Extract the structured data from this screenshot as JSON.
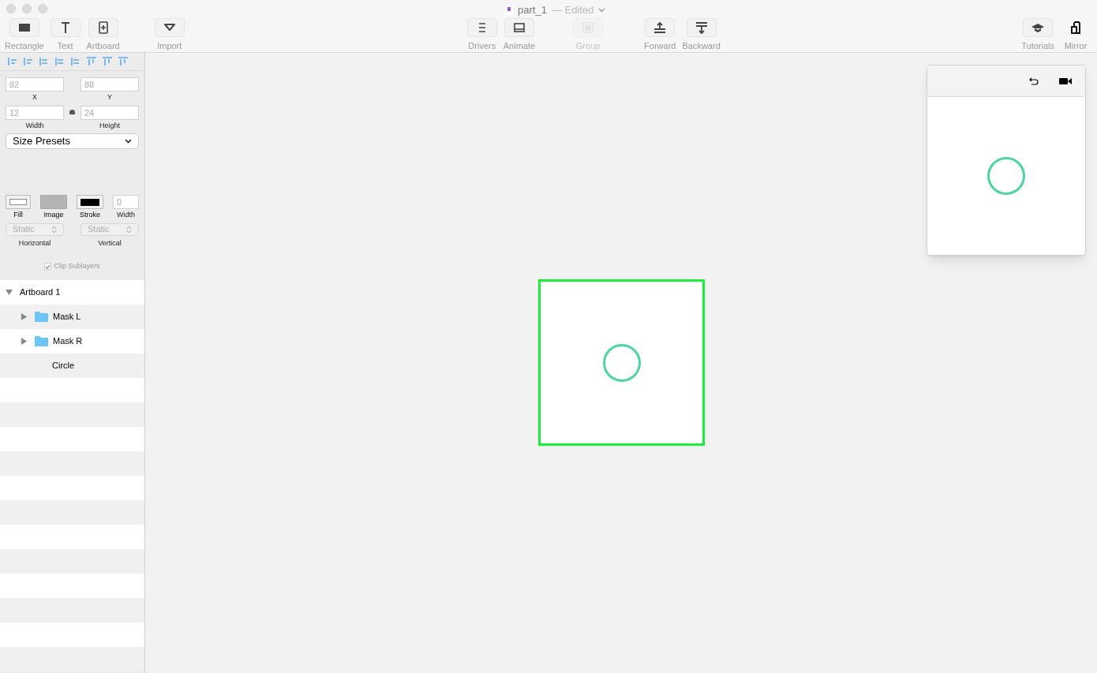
{
  "window": {
    "title": "part_1",
    "status": "— Edited"
  },
  "toolbar": [
    {
      "label": "Rectangle",
      "disabled": false
    },
    {
      "label": "Text",
      "disabled": false
    },
    {
      "label": "Artboard",
      "disabled": false
    },
    {
      "label": "Import",
      "disabled": false
    },
    {
      "label": "Drivers",
      "disabled": false
    },
    {
      "label": "Animate",
      "disabled": false
    },
    {
      "label": "Group",
      "disabled": true
    },
    {
      "label": "Forward",
      "disabled": false
    },
    {
      "label": "Backward",
      "disabled": false
    },
    {
      "label": "Tutorials",
      "disabled": false
    },
    {
      "label": "Mirror",
      "disabled": false
    }
  ],
  "inspector": {
    "x": {
      "value": "82",
      "label": "X"
    },
    "y": {
      "value": "88",
      "label": "Y"
    },
    "width": {
      "value": "12",
      "label": "Width"
    },
    "height": {
      "value": "24",
      "label": "Height"
    },
    "size_presets": "Size Presets",
    "fill": "Fill",
    "image": "Image",
    "stroke": "Stroke",
    "stroke_width": {
      "value": "0",
      "label": "Width"
    },
    "horizontal": {
      "value": "Static",
      "label": "Horizontal"
    },
    "vertical": {
      "value": "Static",
      "label": "Vertical"
    },
    "clip_sublayers": {
      "label": "Clip Sublayers",
      "checked": true
    }
  },
  "layers": [
    {
      "name": "Artboard 1",
      "expanded": true,
      "children": [
        {
          "name": "Mask L",
          "kind": "folder",
          "expanded": false
        },
        {
          "name": "Mask R",
          "kind": "folder",
          "expanded": false
        },
        {
          "name": "Circle",
          "kind": "shape"
        }
      ]
    }
  ]
}
